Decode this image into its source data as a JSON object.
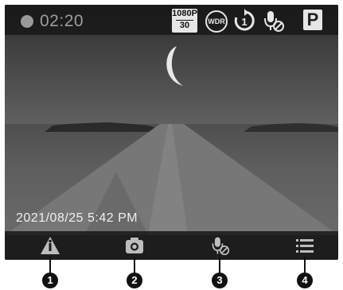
{
  "status_bar": {
    "recording_time": "02:20",
    "resolution_top": "1080P",
    "resolution_bottom": "30",
    "wdr_label": "WDR",
    "loop_label": "1",
    "parking_label": "P",
    "icons": [
      "record-indicator-icon",
      "resolution-badge",
      "wdr-icon",
      "loop-recording-icon",
      "microphone-off-icon",
      "parking-mode-icon"
    ]
  },
  "overlay": {
    "timestamp": "2021/08/25 5:42 PM"
  },
  "toolbar": {
    "buttons": [
      {
        "icon": "event-alert-icon",
        "callout": "1"
      },
      {
        "icon": "camera-icon",
        "callout": "2"
      },
      {
        "icon": "microphone-off-icon",
        "callout": "3"
      },
      {
        "icon": "menu-icon",
        "callout": "4"
      }
    ]
  },
  "colors": {
    "statusbar_bg": "#141414",
    "icon_light": "#e6e6e6",
    "rec_dot": "#9a9a9a",
    "toolbar_icon": "#bdbdbd"
  }
}
